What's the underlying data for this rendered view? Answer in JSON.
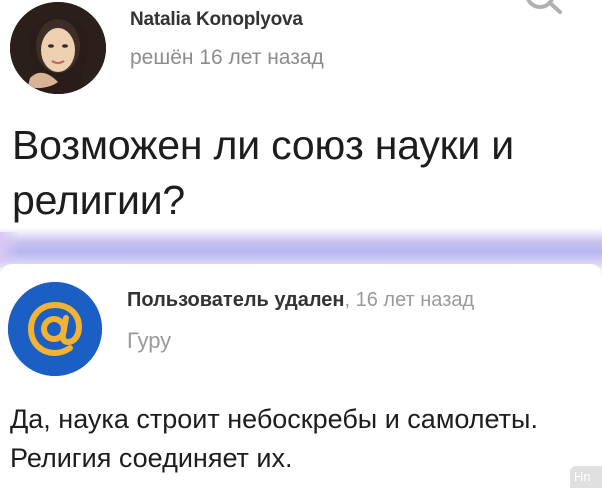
{
  "question": {
    "author_name": "Natalia Konoplyova",
    "meta": "решён 16 лет назад",
    "title": "Возможен ли союз науки и религии?"
  },
  "answer": {
    "author_name": "Пользователь удален",
    "time": ", 16 лет назад",
    "rank": "Гуру",
    "text": "Да, наука строит небоскребы и самолеты. Религия соединяет их."
  },
  "icons": {
    "search": "search-icon",
    "answer_avatar": "at-sign-icon"
  },
  "colors": {
    "answer_avatar_bg": "#1b5fc4",
    "answer_avatar_ring": "#f2b233"
  }
}
